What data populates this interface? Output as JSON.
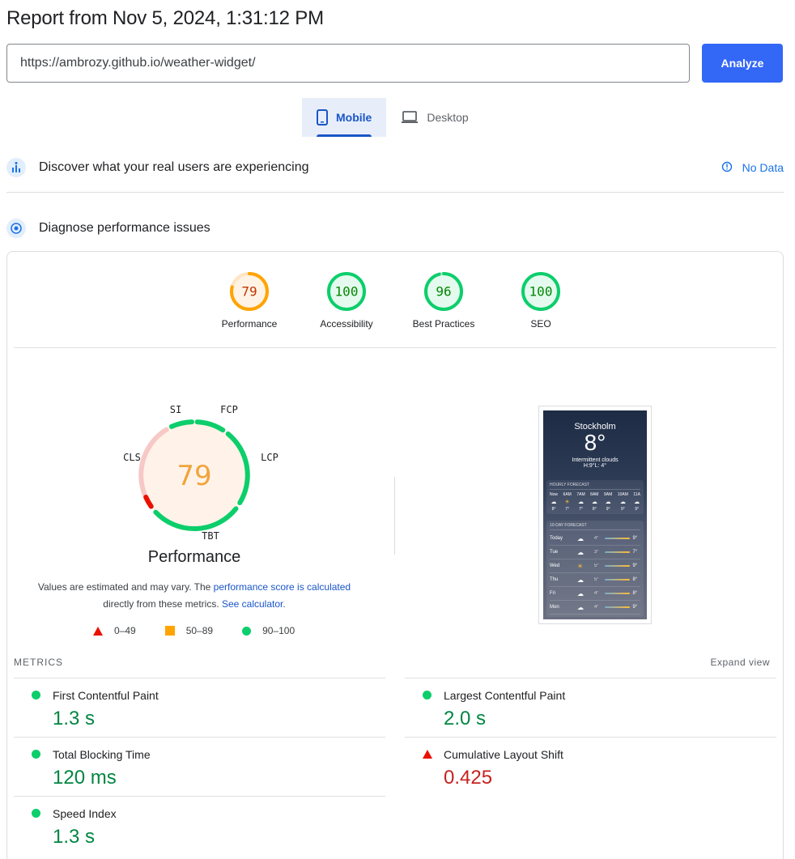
{
  "header": {
    "title": "Report from Nov 5, 2024, 1:31:12 PM",
    "url_value": "https://ambrozy.github.io/weather-widget/",
    "analyze_label": "Analyze"
  },
  "tabs": [
    {
      "label": "Mobile",
      "icon": "phone-icon",
      "active": true
    },
    {
      "label": "Desktop",
      "icon": "laptop-icon",
      "active": false
    }
  ],
  "real_users": {
    "title": "Discover what your real users are experiencing",
    "status": "No Data"
  },
  "diagnose": {
    "title": "Diagnose performance issues"
  },
  "scores": [
    {
      "label": "Performance",
      "value": "79",
      "score": 79,
      "status": "average"
    },
    {
      "label": "Accessibility",
      "value": "100",
      "score": 100,
      "status": "pass"
    },
    {
      "label": "Best Practices",
      "value": "96",
      "score": 96,
      "status": "pass"
    },
    {
      "label": "SEO",
      "value": "100",
      "score": 100,
      "status": "pass"
    }
  ],
  "performance": {
    "score": "79",
    "title": "Performance",
    "desc_before": "Values are estimated and may vary. The ",
    "desc_link1": "performance score is calculated",
    "desc_middle": "directly from these metrics. ",
    "desc_link2": "See calculator.",
    "segments": [
      {
        "label": "SI"
      },
      {
        "label": "FCP"
      },
      {
        "label": "LCP"
      },
      {
        "label": "TBT"
      },
      {
        "label": "CLS"
      }
    ]
  },
  "legend": [
    {
      "range": "0–49",
      "shape": "triangle",
      "color": "#eb0f00"
    },
    {
      "range": "50–89",
      "shape": "square",
      "color": "#ffa400"
    },
    {
      "range": "90–100",
      "shape": "circle",
      "color": "#0cce6b"
    }
  ],
  "screenshot": {
    "city": "Stockholm",
    "temp": "8°",
    "condition": "Intermittent clouds",
    "hilo": "H:9°L: 4°",
    "hourly_title": "HOURLY FORECAST",
    "hours": [
      {
        "t": "Now",
        "v": "8°",
        "icon": "cloud"
      },
      {
        "t": "6AM",
        "v": "7°",
        "icon": "sun"
      },
      {
        "t": "7AM",
        "v": "7°",
        "icon": "cloud"
      },
      {
        "t": "8AM",
        "v": "8°",
        "icon": "cloud"
      },
      {
        "t": "9AM",
        "v": "9°",
        "icon": "cloud"
      },
      {
        "t": "10AM",
        "v": "9°",
        "icon": "cloud"
      },
      {
        "t": "11A",
        "v": "9°",
        "icon": "cloud"
      }
    ],
    "daily_title": "10-DAY FORECAST",
    "days": [
      {
        "d": "Today",
        "lo": "4°",
        "hi": "9°",
        "icon": "cloud"
      },
      {
        "d": "Tue",
        "lo": "3°",
        "hi": "7°",
        "icon": "cloud"
      },
      {
        "d": "Wed",
        "lo": "5°",
        "hi": "9°",
        "icon": "sun"
      },
      {
        "d": "Thu",
        "lo": "5°",
        "hi": "8°",
        "icon": "cloud"
      },
      {
        "d": "Fri",
        "lo": "4°",
        "hi": "8°",
        "icon": "cloud"
      },
      {
        "d": "Mon",
        "lo": "4°",
        "hi": "9°",
        "icon": "cloud"
      }
    ]
  },
  "metrics": {
    "heading": "METRICS",
    "expand_label": "Expand view",
    "items": [
      {
        "name": "First Contentful Paint",
        "value": "1.3 s",
        "status": "good"
      },
      {
        "name": "Largest Contentful Paint",
        "value": "2.0 s",
        "status": "good"
      },
      {
        "name": "Total Blocking Time",
        "value": "120 ms",
        "status": "good"
      },
      {
        "name": "Cumulative Layout Shift",
        "value": "0.425",
        "status": "bad"
      },
      {
        "name": "Speed Index",
        "value": "1.3 s",
        "status": "good"
      }
    ]
  },
  "colors": {
    "accent": "#3367f6",
    "pass": "#0cce6b",
    "average": "#ffa400",
    "fail": "#eb0f00"
  }
}
